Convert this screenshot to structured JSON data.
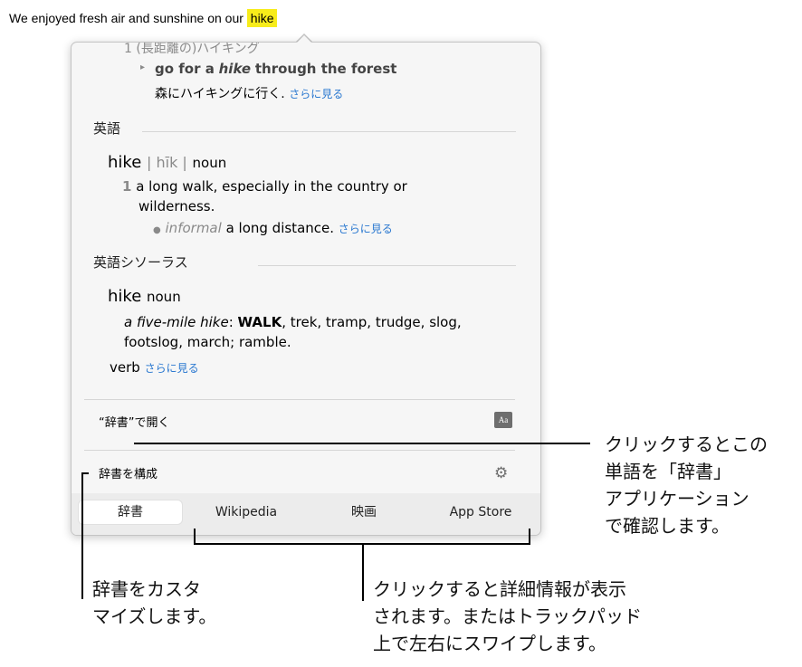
{
  "sentence": {
    "text": "We enjoyed fresh air and sunshine on our",
    "highlight": "hike"
  },
  "popover": {
    "jp_section": {
      "cut_header": "1 (長距離の)ハイキング",
      "example_en_pre": "go for a",
      "example_en_em": "hike",
      "example_en_post": "through the forest",
      "example_ja": "森にハイキングに行く.",
      "more": "さらに見る"
    },
    "english": {
      "title": "英語",
      "headword": "hike",
      "pron": "| hīk |",
      "pos": "noun",
      "sense_num": "1",
      "def_line1": "a long walk, especially in the country or",
      "def_line2": "wilderness.",
      "sub_label": "informal",
      "sub_text": "a long distance.",
      "more": "さらに見る"
    },
    "thesaurus": {
      "title": "英語シソーラス",
      "headword": "hike",
      "pos": "noun",
      "ex_em": "a five-mile hike",
      "ex_colon": ":",
      "ex_main": "WALK",
      "ex_rest1": ", trek, tramp, trudge, slog,",
      "ex_rest2": "footslog, march; ramble.",
      "verb": "verb",
      "more": "さらに見る"
    },
    "open_in_dictionary": "“辞書”で開く",
    "dict_icon": "Aa",
    "configure": "辞書を構成",
    "tabs": [
      "辞書",
      "Wikipedia",
      "映画",
      "App Store"
    ]
  },
  "callouts": {
    "open_dict": [
      "クリックするとこの",
      "単語を「辞書」",
      "アプリケーション",
      "で確認します。"
    ],
    "customize": [
      "辞書をカスタ",
      "マイズします。"
    ],
    "tabs_info": [
      "クリックすると詳細情報が表示",
      "されます。またはトラックパッド",
      "上で左右にスワイプします。"
    ]
  }
}
